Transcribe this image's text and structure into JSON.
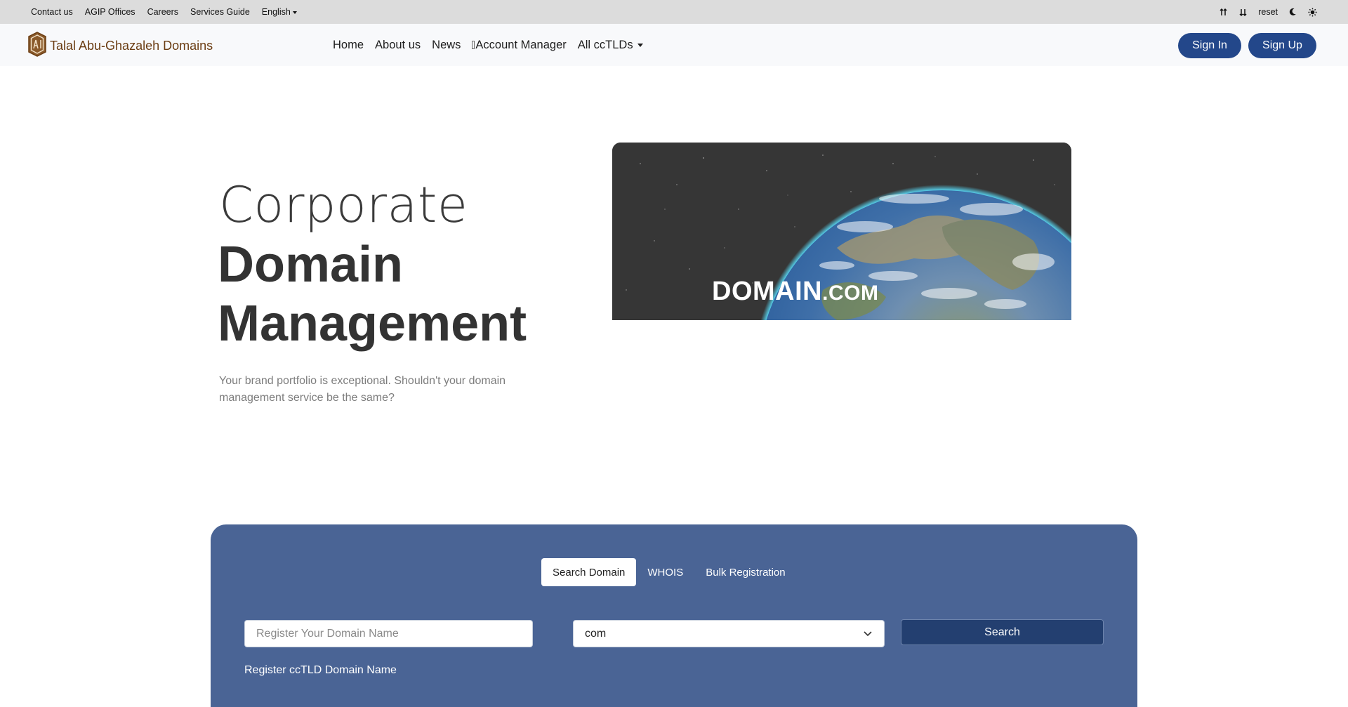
{
  "topbar": {
    "links": [
      "Contact us",
      "AGIP Offices",
      "Careers",
      "Services Guide"
    ],
    "language": "English",
    "tools": {
      "increase_icon": "font-increase-icon",
      "decrease_icon": "font-decrease-icon",
      "reset": "reset",
      "dark_icon": "moon-icon",
      "light_icon": "sun-icon"
    }
  },
  "navbar": {
    "brand": "Talal Abu-Ghazaleh Domains",
    "items": [
      "Home",
      "About us",
      "News",
      "Account Manager"
    ],
    "dropdown": "All ccTLDs",
    "sign_in": "Sign In",
    "sign_up": "Sign Up"
  },
  "hero": {
    "title_light": "Corporate",
    "title_bold_1": "Domain",
    "title_bold_2": "Management",
    "subtitle": "Your brand portfolio is exceptional. Shouldn't your domain management service be the same?",
    "image_word": "DOMAIN",
    "image_tld": ".COM"
  },
  "search": {
    "tabs": [
      "Search Domain",
      "WHOIS",
      "Bulk Registration"
    ],
    "active_tab": "Search Domain",
    "placeholder": "Register Your Domain Name",
    "tld_selected": "com",
    "button": "Search",
    "hint": "Register ccTLD Domain Name"
  },
  "colors": {
    "brand_brown": "#6b3d13",
    "primary_blue": "#23478a",
    "panel_blue": "#4a6495",
    "button_dark": "#233f70"
  }
}
